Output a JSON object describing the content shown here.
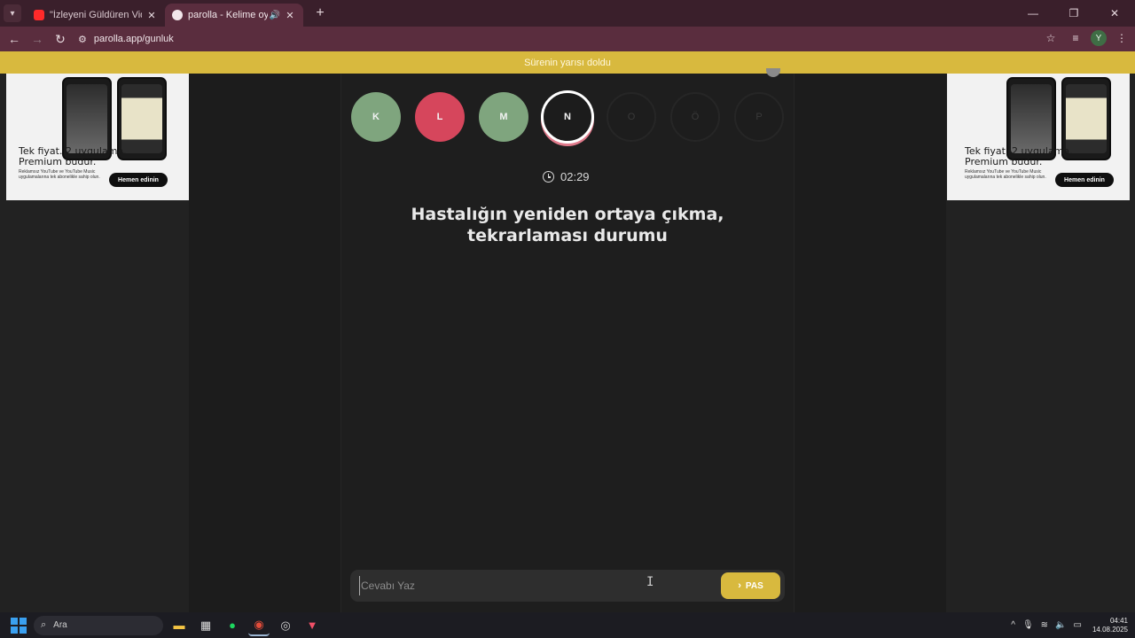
{
  "browser": {
    "tabs": [
      {
        "title": "\"İzleyeni Güldüren Video\" Kick",
        "active": false,
        "favicon": "youtube-icon"
      },
      {
        "title": "parolla - Kelime oyunu. Gün",
        "active": true,
        "favicon": "parolla-icon"
      }
    ],
    "url": "parolla.app/gunluk",
    "profile_initial": "Y"
  },
  "banner": {
    "text": "Sürenin yarısı doldu"
  },
  "ads": {
    "headline_line1": "Tek fiyat. 2 uygulama.",
    "headline_line2": "Premium budur.",
    "body": "Reklamsız YouTube ve YouTube Music uygulamalarına tek abonelikle sahip olun.",
    "cta": "Hemen edinin"
  },
  "game": {
    "letters": [
      {
        "char": "K",
        "state": "correct"
      },
      {
        "char": "L",
        "state": "wrong"
      },
      {
        "char": "M",
        "state": "correct"
      },
      {
        "char": "N",
        "state": "current"
      },
      {
        "char": "O",
        "state": "pending"
      },
      {
        "char": "Ö",
        "state": "pending"
      },
      {
        "char": "P",
        "state": "pending"
      }
    ],
    "timer": "02:29",
    "question_line1": "Hastalığın yeniden ortaya çıkma,",
    "question_line2": "tekrarlaması durumu",
    "answer_placeholder": "Cevabı Yaz",
    "pass_label": "PAS"
  },
  "colors": {
    "correct": "#7fa57e",
    "wrong": "#d6465c",
    "accent": "#d8b93e"
  },
  "taskbar": {
    "search_label": "Ara",
    "time": "04:41",
    "date": "14.08.2025"
  }
}
